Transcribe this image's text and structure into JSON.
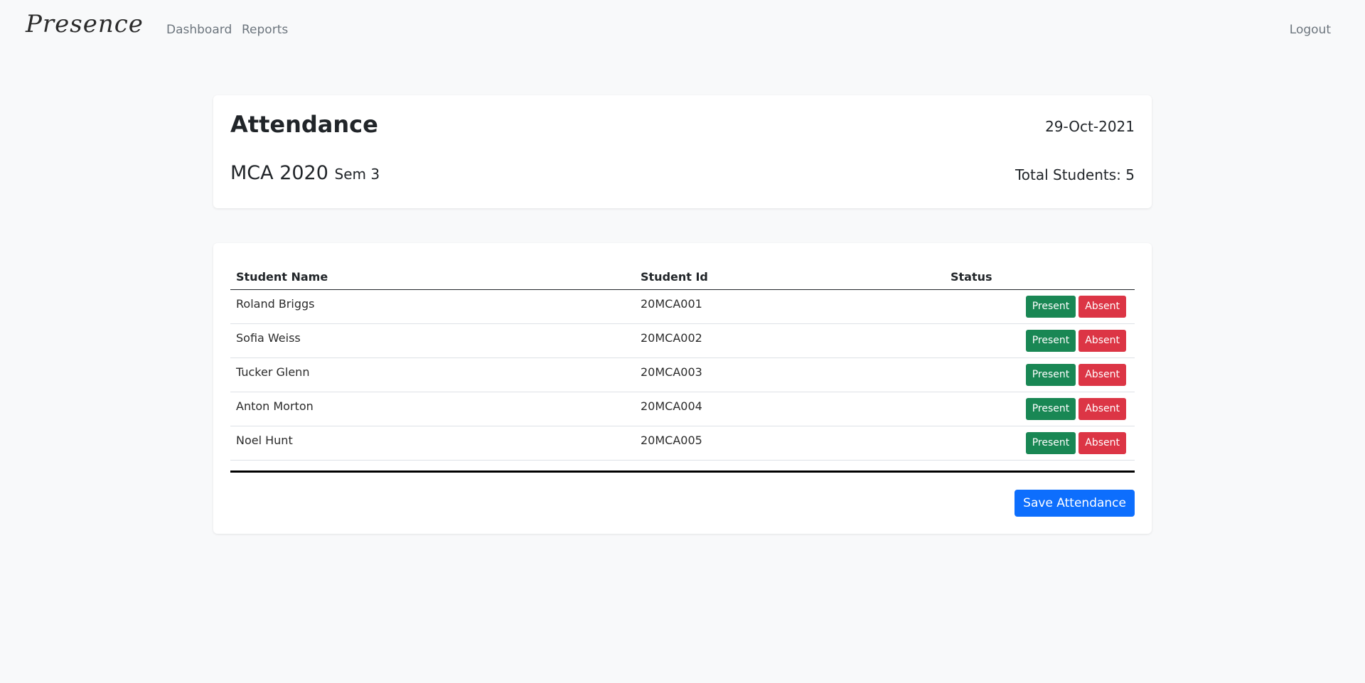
{
  "navbar": {
    "brand": "Presence",
    "links": [
      {
        "label": "Dashboard"
      },
      {
        "label": "Reports"
      }
    ],
    "logout": "Logout"
  },
  "header": {
    "title": "Attendance",
    "date": "29-Oct-2021",
    "class_name": "MCA 2020",
    "semester": "Sem 3",
    "total_students": "Total Students: 5"
  },
  "table": {
    "columns": [
      "Student Name",
      "Student Id",
      "Status"
    ],
    "rows": [
      {
        "name": "Roland Briggs",
        "id": "20MCA001"
      },
      {
        "name": "Sofia Weiss",
        "id": "20MCA002"
      },
      {
        "name": "Tucker Glenn",
        "id": "20MCA003"
      },
      {
        "name": "Anton Morton",
        "id": "20MCA004"
      },
      {
        "name": "Noel Hunt",
        "id": "20MCA005"
      }
    ],
    "present_label": "Present",
    "absent_label": "Absent"
  },
  "save_label": "Save Attendance",
  "colors": {
    "background": "#f8f9fa",
    "present": "#198754",
    "absent": "#dc3545",
    "primary": "#0d6efd"
  }
}
